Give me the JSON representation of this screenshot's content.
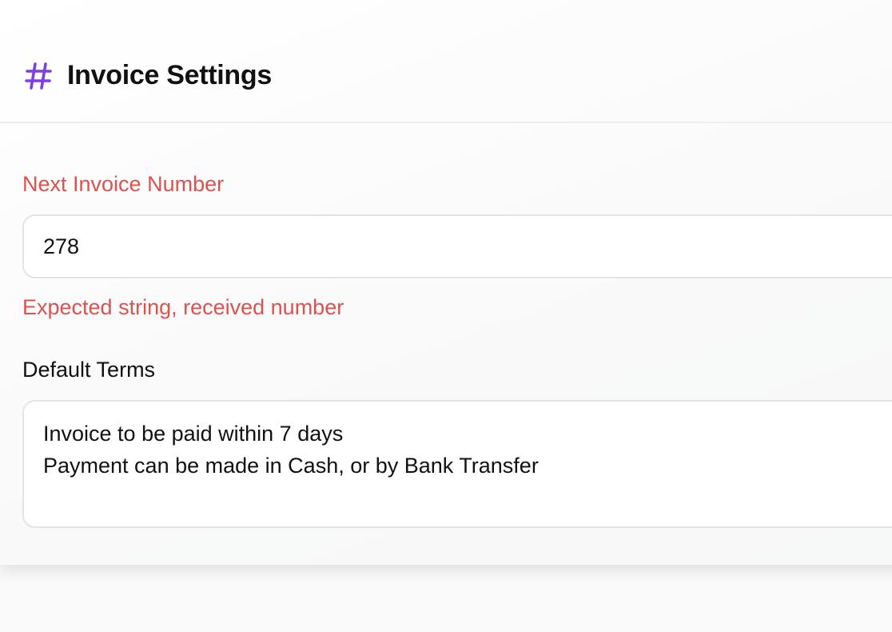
{
  "header": {
    "icon": "hash-icon",
    "icon_color": "#7b3fe4",
    "title": "Invoice Settings"
  },
  "form": {
    "next_invoice_number": {
      "label": "Next Invoice Number",
      "value": "278",
      "error": "Expected string, received number",
      "error_color": "#d9534f"
    },
    "default_terms": {
      "label": "Default Terms",
      "value": "Invoice to be paid within 7 days\nPayment can be made in Cash, or by Bank Transfer"
    }
  }
}
